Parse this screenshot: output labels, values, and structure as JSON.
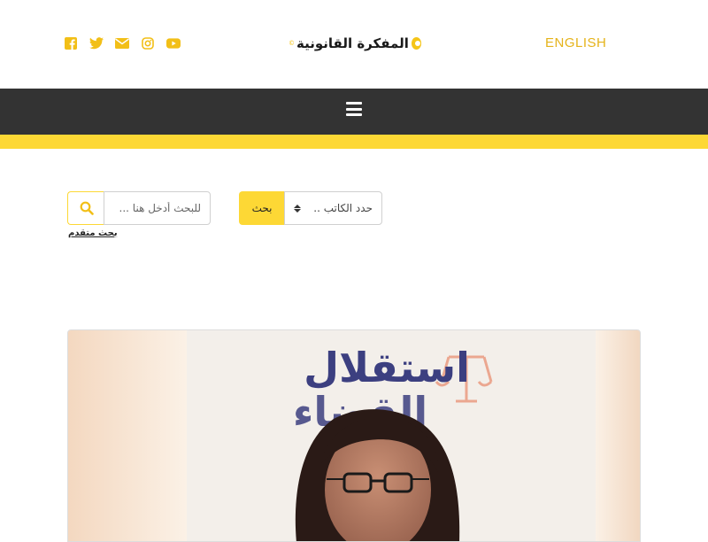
{
  "header": {
    "social_icons": [
      "facebook-icon",
      "twitter-icon",
      "envelope-icon",
      "instagram-icon",
      "youtube-icon"
    ],
    "logo": {
      "text": "المفكرة القانونية",
      "tag": "©"
    },
    "language_link": "ENGLISH"
  },
  "nav": {
    "menu_icon": "hamburger-icon"
  },
  "search": {
    "keyword_placeholder": "للبحث أدخل هنا ...",
    "advanced_link": "بحث متقدم",
    "author_select_value": "حدد الكاتب ..",
    "submit_label": "بحث"
  },
  "featured": {
    "image_banner_text_line1": "استقلال",
    "image_banner_text_line2": "القضاء"
  },
  "colors": {
    "accent_yellow": "#fdd835",
    "lang_gold": "#e5b31a",
    "social_gold": "#f2bf17",
    "nav_dark": "#333333"
  }
}
